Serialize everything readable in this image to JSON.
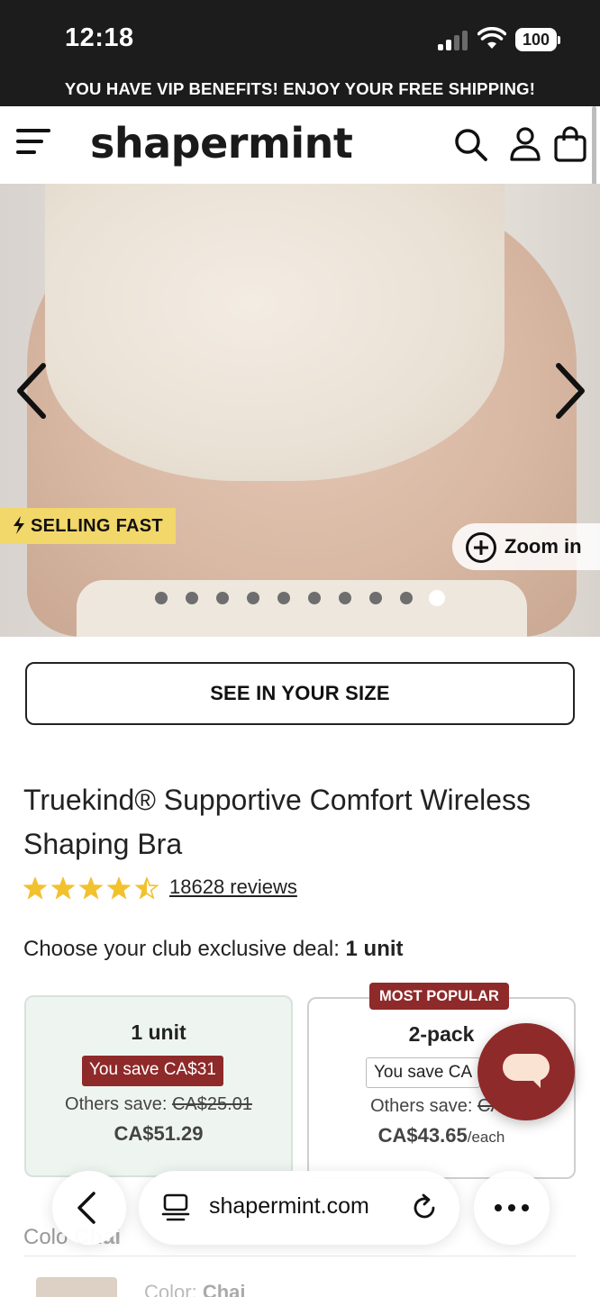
{
  "status_bar": {
    "time": "12:18",
    "battery": "100"
  },
  "promo": {
    "text": "YOU HAVE VIP BENEFITS! ENJOY YOUR FREE SHIPPING!"
  },
  "header": {
    "logo": "shapermint",
    "icons": [
      "menu-icon",
      "search-icon",
      "account-icon",
      "bag-icon"
    ]
  },
  "hero": {
    "badge": "SELLING FAST",
    "zoom_label": "Zoom in",
    "carousel": {
      "total_slides": 10,
      "active_slide": 10
    }
  },
  "size_button": {
    "label": "SEE IN YOUR SIZE"
  },
  "product": {
    "title": "Truekind® Supportive Comfort Wireless Shaping Bra",
    "rating": 4.5,
    "reviews": "18628 reviews"
  },
  "deal": {
    "label": "Choose your club exclusive deal:",
    "selected": "1 unit",
    "options": [
      {
        "title": "1 unit",
        "badge": "You save CA$31",
        "others_label": "Others save:",
        "others_value": "CA$25.01",
        "price": "CA$51.29",
        "price_suffix": ""
      },
      {
        "tag": "MOST POPULAR",
        "title": "2-pack",
        "badge": "You save CA",
        "others_label": "Others save:",
        "others_value": "CA$",
        "price": "CA$43.65",
        "price_suffix": "/each"
      }
    ]
  },
  "color": {
    "label": "Colo",
    "value": "Chai",
    "row2_label": "Color:",
    "row2_value": "Chai"
  },
  "browser": {
    "domain": "shapermint.com"
  },
  "colors": {
    "accent": "#8f2a2a",
    "badge_yellow": "#f2d76a",
    "card_selected_bg": "#eef5f1"
  }
}
